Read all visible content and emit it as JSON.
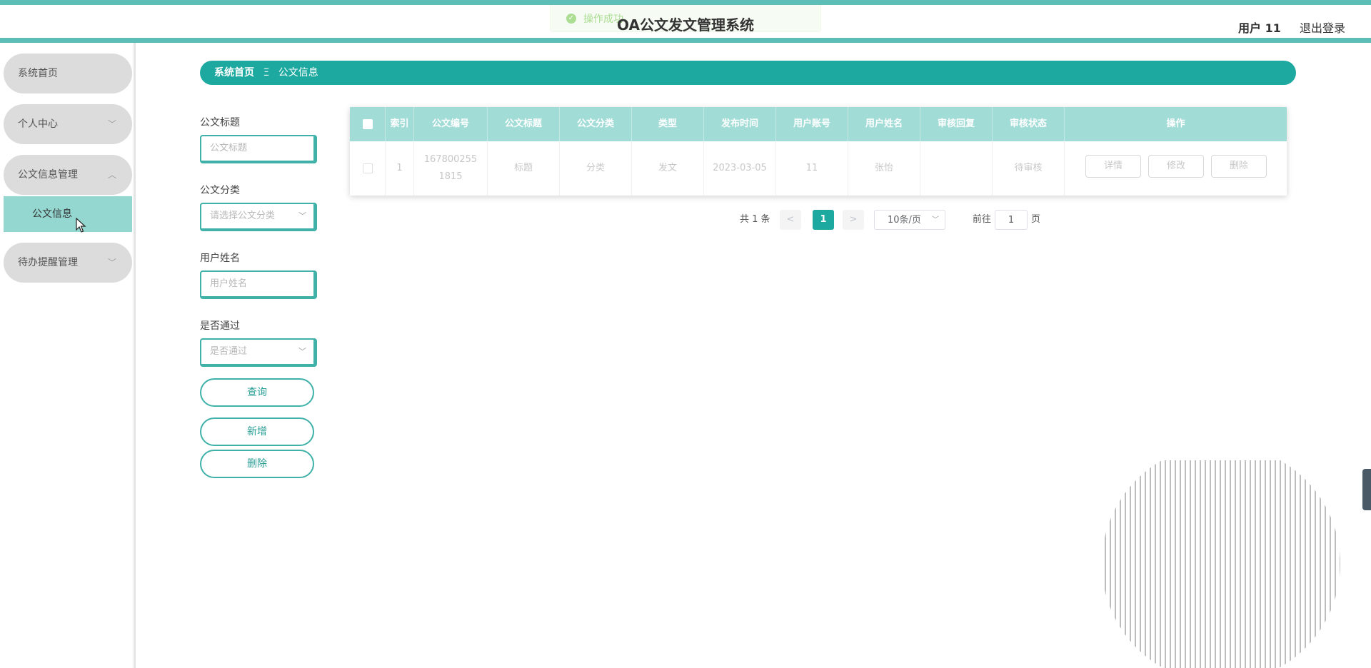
{
  "header": {
    "title": "OA公文发文管理系统",
    "user": "用户 11",
    "logout": "退出登录",
    "toast": "操作成功"
  },
  "sidebar": {
    "items": [
      {
        "label": "系统首页"
      },
      {
        "label": "个人中心"
      },
      {
        "label": "公文信息管理"
      },
      {
        "label": "待办提醒管理"
      }
    ],
    "sub_item": "公文信息"
  },
  "breadcrumb": {
    "home": "系统首页",
    "separator": "Ξ",
    "current": "公文信息"
  },
  "filters": {
    "title_label": "公文标题",
    "title_placeholder": "公文标题",
    "category_label": "公文分类",
    "category_placeholder": "请选择公文分类",
    "username_label": "用户姓名",
    "username_placeholder": "用户姓名",
    "pass_label": "是否通过",
    "pass_placeholder": "是否通过"
  },
  "buttons": {
    "query": "查询",
    "add": "新增",
    "delete": "删除"
  },
  "table": {
    "headers": [
      "索引",
      "公文编号",
      "公文标题",
      "公文分类",
      "类型",
      "发布时间",
      "用户账号",
      "用户姓名",
      "审核回复",
      "审核状态",
      "操作"
    ],
    "row": {
      "index": "1",
      "doc_no_line1": "167800255",
      "doc_no_line2": "1815",
      "title": "标题",
      "category": "分类",
      "type": "发文",
      "date": "2023-03-05",
      "account": "11",
      "username": "张怡",
      "reply": "",
      "status": "待审核"
    },
    "actions": {
      "detail": "详情",
      "edit": "修改",
      "remove": "删除"
    }
  },
  "pagination": {
    "total": "共 1 条",
    "prev": "<",
    "page": "1",
    "next": ">",
    "page_size": "10条/页",
    "goto_label": "前往",
    "goto_value": "1",
    "page_suffix": "页"
  },
  "colors": {
    "accent": "#1ea9a0",
    "header_bar": "#5dbeb7",
    "table_header": "#a2dcd7",
    "active_menu": "#93d7d0"
  }
}
